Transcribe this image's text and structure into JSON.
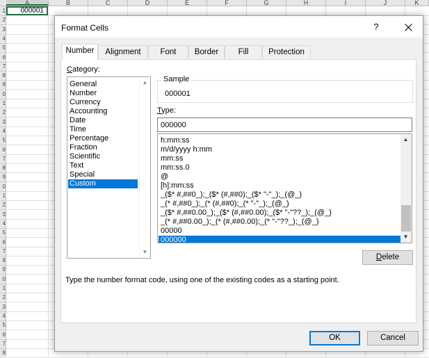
{
  "sheet": {
    "columns": [
      "A",
      "B",
      "C",
      "D",
      "E",
      "F",
      "G",
      "H",
      "I",
      "J",
      "K"
    ],
    "rows": [
      "1",
      "2",
      "3",
      "4",
      "5",
      "6",
      "7",
      "8",
      "9",
      "0",
      "1",
      "2",
      "3",
      "4",
      "5",
      "6",
      "7",
      "8",
      "9",
      "0",
      "1",
      "2",
      "3",
      "4",
      "5",
      "6",
      "7",
      "8",
      "9",
      "0",
      "1",
      "2",
      "3",
      "4",
      "5",
      "6",
      "7",
      "8"
    ],
    "cell_a1": "000001"
  },
  "dialog": {
    "title": "Format Cells",
    "help": "?",
    "close": "✕",
    "tabs": [
      "Number",
      "Alignment",
      "Font",
      "Border",
      "Fill",
      "Protection"
    ],
    "category_label_prefix": "C",
    "category_label_rest": "ategory:",
    "categories": [
      "General",
      "Number",
      "Currency",
      "Accounting",
      "Date",
      "Time",
      "Percentage",
      "Fraction",
      "Scientific",
      "Text",
      "Special",
      "Custom"
    ],
    "selected_category": "Custom",
    "sample_label": "Sample",
    "sample_value": "000001",
    "type_label_prefix": "T",
    "type_label_rest": "ype:",
    "type_value": "000000",
    "format_codes": [
      "h:mm:ss",
      "m/d/yyyy h:mm",
      "mm:ss",
      "mm:ss.0",
      "@",
      "[h]:mm:ss",
      "_($* #,##0_);_($* (#,##0);_($* \"-\"_);_(@_)",
      "_(* #,##0_);_(* (#,##0);_(* \"-\"_);_(@_)",
      "_($* #,##0.00_);_($* (#,##0.00);_($* \"-\"??_);_(@_)",
      "_(* #,##0.00_);_(* (#,##0.00);_(* \"-\"??_);_(@_)",
      "00000",
      "000000"
    ],
    "selected_format": "000000",
    "delete_prefix": "D",
    "delete_rest": "elete",
    "hint": "Type the number format code, using one of the existing codes as a starting point.",
    "ok": "OK",
    "cancel": "Cancel"
  },
  "colors": {
    "accent": "#0078d7",
    "excel_green": "#217346"
  }
}
